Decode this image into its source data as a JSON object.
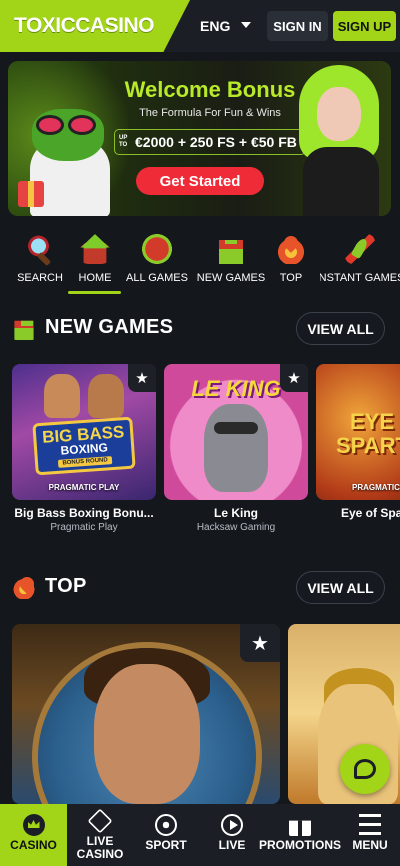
{
  "header": {
    "logo_text": "TOXICCASINO",
    "language": "ENG",
    "sign_in_label": "SIGN IN",
    "sign_up_label": "SIGN UP"
  },
  "banner": {
    "title": "Welcome Bonus",
    "subtitle": "The Formula For Fun & Wins",
    "upto_label": "UP TO",
    "offer": "€2000 + 250 FS + €50 FB",
    "cta_label": "Get Started"
  },
  "categories": [
    {
      "label": "SEARCH",
      "icon": "search-icon"
    },
    {
      "label": "HOME",
      "icon": "home-icon",
      "active": true
    },
    {
      "label": "ALL GAMES",
      "icon": "all-games-icon"
    },
    {
      "label": "NEW GAMES",
      "icon": "new-games-icon"
    },
    {
      "label": "TOP",
      "icon": "top-icon"
    },
    {
      "label": "INSTANT GAMES",
      "icon": "instant-games-icon"
    }
  ],
  "new_games": {
    "title": "NEW GAMES",
    "view_all_label": "VIEW ALL",
    "games": [
      {
        "name": "Big Bass Boxing Bonu...",
        "provider": "Pragmatic Play",
        "tag": "PRAGMATIC PLAY",
        "art_title_1": "BIG BASS",
        "art_title_2": "BOXING",
        "art_title_3": "BONUS ROUND"
      },
      {
        "name": "Le King",
        "provider": "Hacksaw Gaming",
        "art_title": "LE KING"
      },
      {
        "name": "Eye of Spa",
        "provider": "",
        "tag": "PRAGMATIC",
        "art_title_1": "EYE",
        "art_title_2": "SPARTA"
      }
    ]
  },
  "top": {
    "title": "TOP",
    "view_all_label": "VIEW ALL"
  },
  "bottom_nav": [
    {
      "label": "CASINO",
      "icon": "crown-icon",
      "active": true
    },
    {
      "label": "LIVE CASINO",
      "icon": "dice-icon"
    },
    {
      "label": "SPORT",
      "icon": "ball-icon"
    },
    {
      "label": "LIVE",
      "icon": "play-icon"
    },
    {
      "label": "PROMOTIONS",
      "icon": "gift-icon"
    },
    {
      "label": "MENU",
      "icon": "menu-icon"
    }
  ],
  "colors": {
    "accent": "#a2d417",
    "background": "#14171c",
    "cta_red": "#ef2b37"
  }
}
